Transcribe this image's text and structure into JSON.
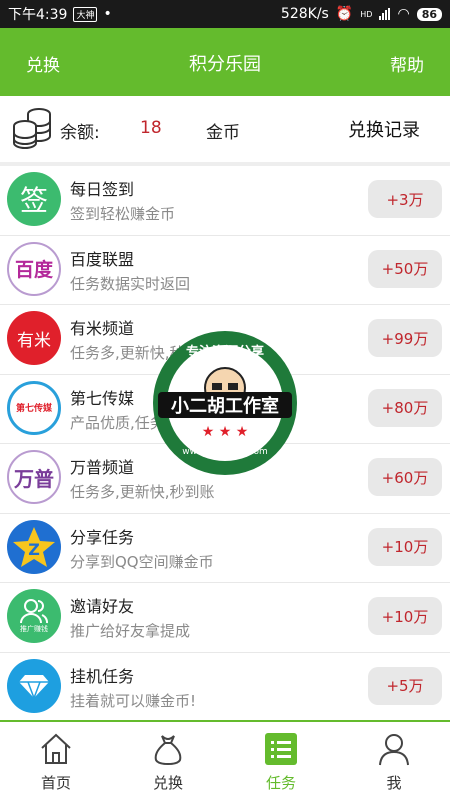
{
  "status_bar": {
    "time": "下午4:39",
    "app_badge": "大神",
    "speed": "528K/s",
    "network": "HD",
    "battery": "86"
  },
  "header": {
    "left_label": "兑换",
    "title": "积分乐园",
    "right_label": "帮助"
  },
  "balance": {
    "label": "余额:",
    "value": "18",
    "unit": "金币",
    "record_link": "兑换记录"
  },
  "tasks": [
    {
      "title": "每日签到",
      "subtitle": "签到轻松赚金币",
      "reward": "+3万",
      "icon_text": "签",
      "icon": "checkin-icon",
      "color": "#3cbb6f"
    },
    {
      "title": "百度联盟",
      "subtitle": "任务数据实时返回",
      "reward": "+50万",
      "icon_text": "百度",
      "icon": "baidu-icon",
      "color": "#b3299a"
    },
    {
      "title": "有米频道",
      "subtitle": "任务多,更新快,秒到账",
      "reward": "+99万",
      "icon_text": "有米",
      "icon": "youmi-icon",
      "color": "#e0202b"
    },
    {
      "title": "第七传媒",
      "subtitle": "产品优质,任务多",
      "reward": "+80万",
      "icon_text": "第七传媒",
      "icon": "diqi-icon",
      "color": "#e0202b"
    },
    {
      "title": "万普频道",
      "subtitle": "任务多,更新快,秒到账",
      "reward": "+60万",
      "icon_text": "万普",
      "icon": "wanpu-icon",
      "color": "#7a3d9a"
    },
    {
      "title": "分享任务",
      "subtitle": "分享到QQ空间赚金币",
      "reward": "+10万",
      "icon_text": "Z",
      "icon": "qzone-icon",
      "color": "#1f6fd1"
    },
    {
      "title": "邀请好友",
      "subtitle": "推广给好友拿提成",
      "reward": "+10万",
      "icon_text": "推广赚钱",
      "icon": "invite-icon",
      "color": "#3cbb6f"
    },
    {
      "title": "挂机任务",
      "subtitle": "挂着就可以赚金币!",
      "reward": "+5万",
      "icon_text": "",
      "icon": "diamond-icon",
      "color": "#1e9fe0"
    }
  ],
  "watermark": {
    "top_text": "专注资源分享",
    "main_text": "小二胡工作室",
    "url": "www.xiaoerhu.com"
  },
  "bottom_nav": [
    {
      "label": "首页",
      "icon": "home-icon",
      "active": false
    },
    {
      "label": "兑换",
      "icon": "bag-icon",
      "active": false
    },
    {
      "label": "任务",
      "icon": "task-list-icon",
      "active": true
    },
    {
      "label": "我",
      "icon": "user-icon",
      "active": false
    }
  ],
  "colors": {
    "brand_green": "#64bb2d",
    "reward_red": "#c0262d"
  }
}
